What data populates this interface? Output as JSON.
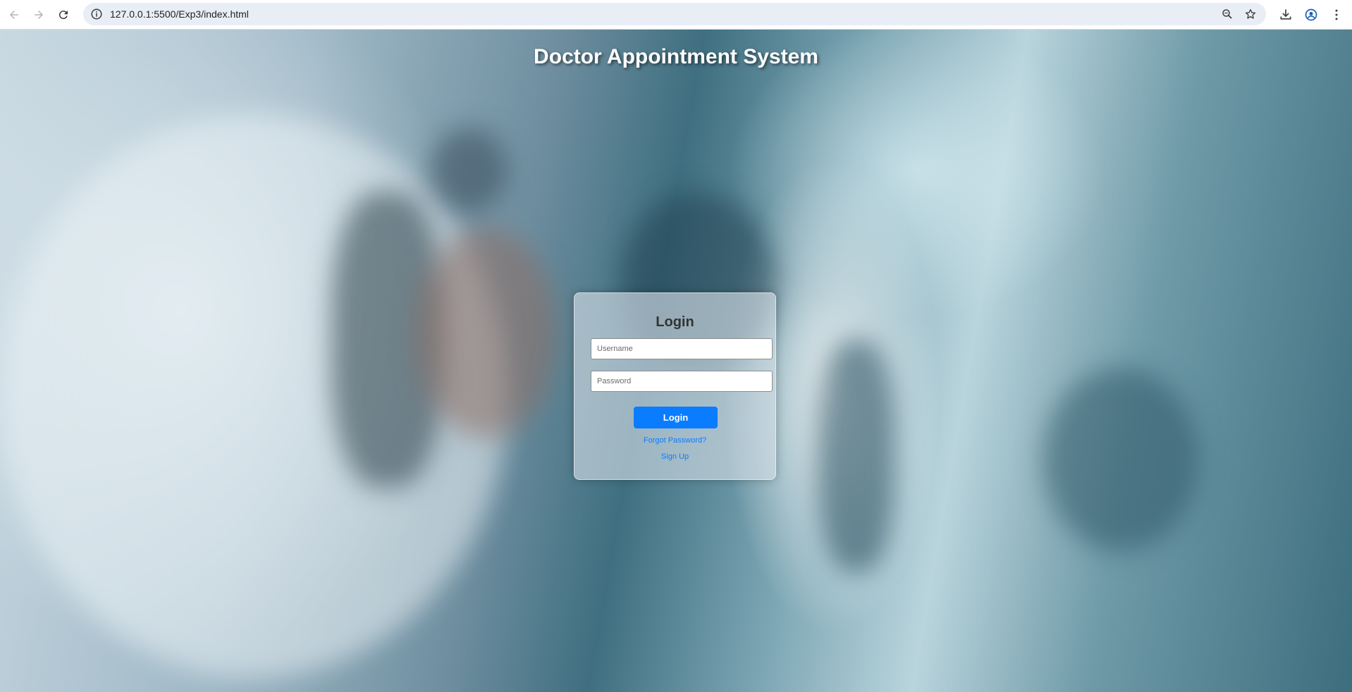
{
  "browser": {
    "url": "127.0.0.1:5500/Exp3/index.html",
    "icons": {
      "back": "back-arrow-icon",
      "forward": "forward-arrow-icon",
      "reload": "reload-icon",
      "site_info": "site-info-icon",
      "zoom": "zoom-icon",
      "bookmark": "star-icon",
      "downloads": "download-icon",
      "profile": "profile-icon",
      "menu": "kebab-menu-icon"
    }
  },
  "page": {
    "title": "Doctor Appointment System"
  },
  "login": {
    "heading": "Login",
    "username_placeholder": "Username",
    "password_placeholder": "Password",
    "button_label": "Login",
    "forgot_link": "Forgot Password?",
    "signup_link": "Sign Up"
  },
  "colors": {
    "accent": "#0a7cff",
    "title_text": "#ffffff",
    "heading_text": "#333333"
  }
}
